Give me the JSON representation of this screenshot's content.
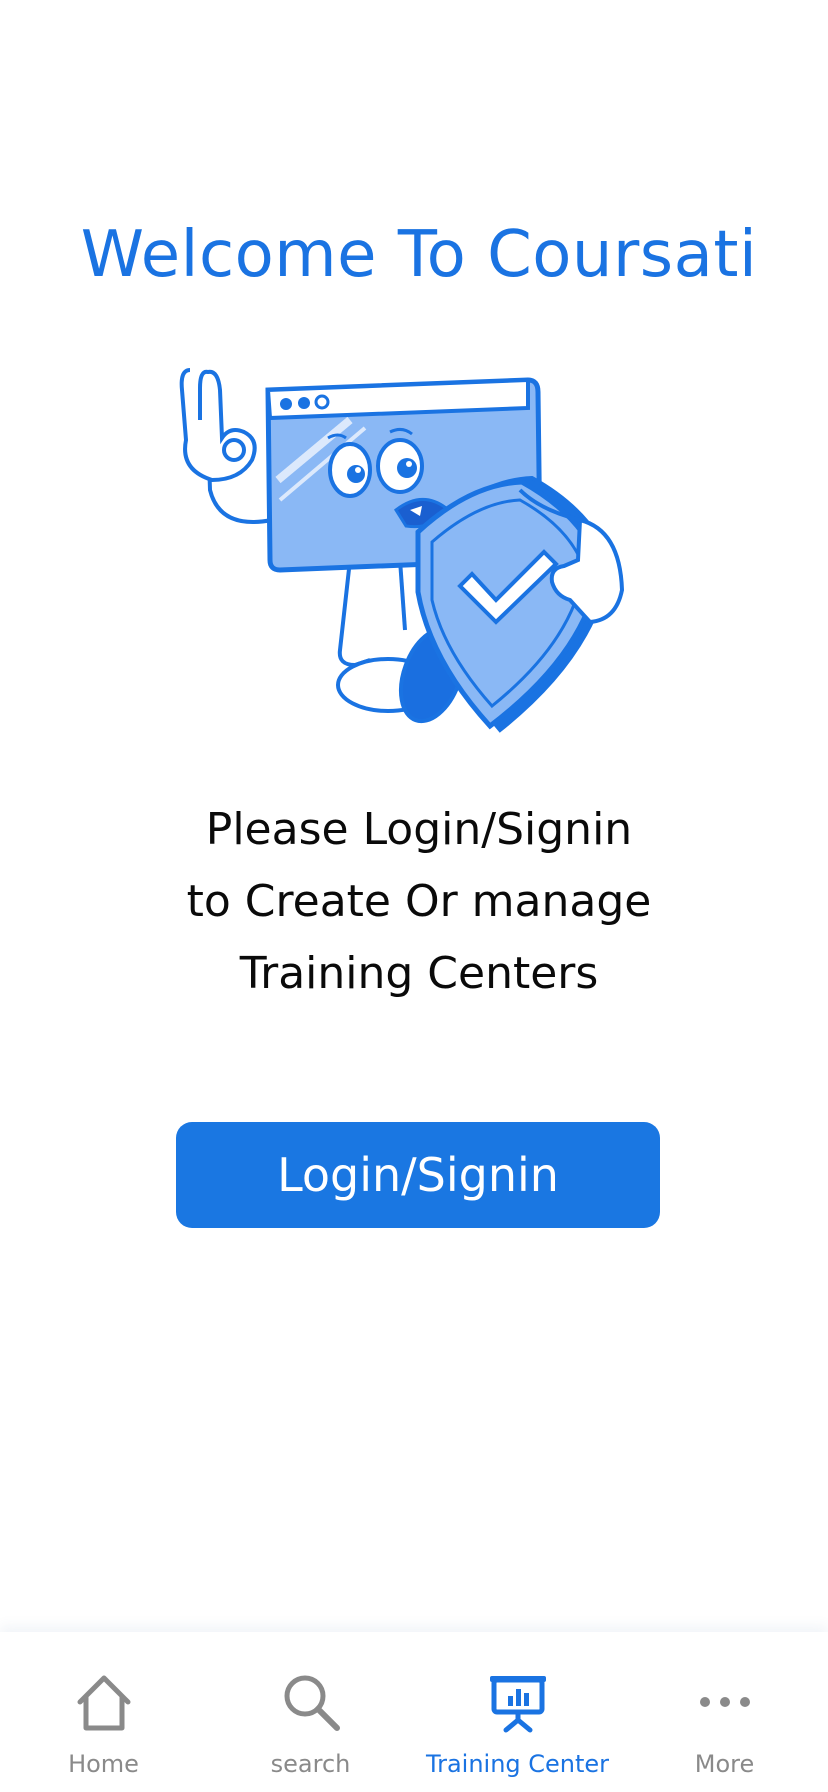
{
  "header": {
    "title": "Welcome To Coursati"
  },
  "illustration": {
    "icon": "security-shield-mascot-illustration"
  },
  "message": {
    "line1": "Please Login/Signin",
    "line2": "to Create Or manage",
    "line3": "Training Centers"
  },
  "actions": {
    "login_label": "Login/Signin"
  },
  "tabbar": {
    "active_tab": "Training Center",
    "items": [
      {
        "label": "Home",
        "icon": "home-icon"
      },
      {
        "label": "search",
        "icon": "search-icon"
      },
      {
        "label": "Training Center",
        "icon": "presentation-board-icon"
      },
      {
        "label": "More",
        "icon": "more-dots-icon"
      }
    ]
  },
  "colors": {
    "accent": "#1a73e2",
    "button": "#1a77e2",
    "text": "#0a0a0a",
    "tab_inactive": "#8a8a8a"
  }
}
